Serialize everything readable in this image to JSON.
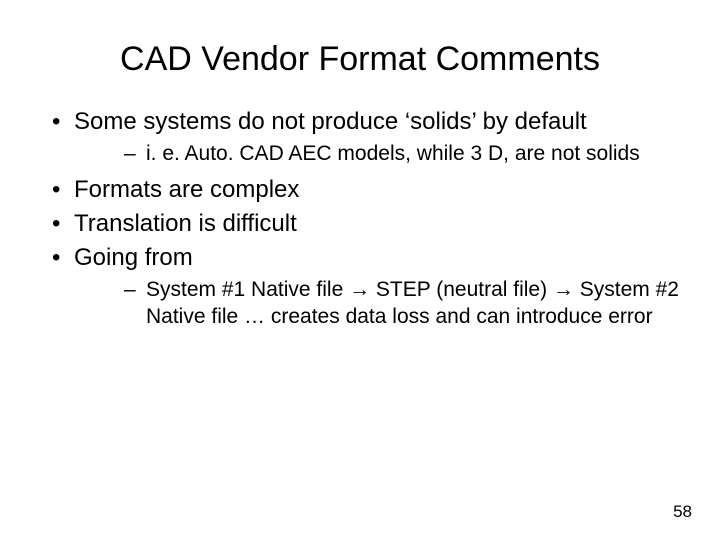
{
  "title": "CAD Vendor Format Comments",
  "bullets": {
    "b1": "Some systems do not produce ‘solids’ by default",
    "b1_sub1": "i. e. Auto. CAD AEC models, while 3 D, are not solids",
    "b2": "Formats are complex",
    "b3": "Translation is difficult",
    "b4": "Going from",
    "b4_sub1": "System #1 Native file → STEP (neutral file) → System #2 Native file … creates data loss and can introduce error"
  },
  "page_number": "58"
}
